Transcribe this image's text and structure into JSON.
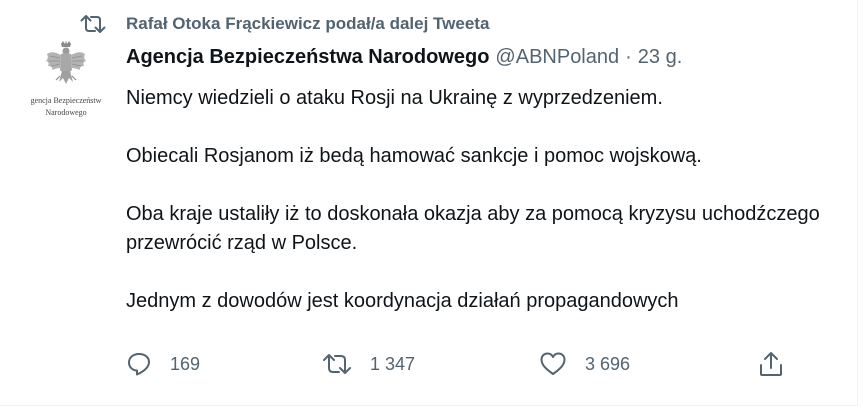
{
  "retweet_context": {
    "icon": "retweet-icon",
    "text": "Rafał Otoka Frąckiewicz podał/a dalej Tweeta"
  },
  "author": {
    "avatar_caption_line1": "gencja Bezpieczeństw",
    "avatar_caption_line2": "Narodowego",
    "name": "Agencja Bezpieczeństwa Narodowego",
    "handle": "@ABNPoland",
    "separator": "·",
    "time": "23 g."
  },
  "tweet": {
    "paragraph1": "Niemcy wiedzieli o ataku Rosji na Ukrainę z wyprzedzeniem.",
    "paragraph2": "Obiecali Rosjanom iż bedą hamować sankcje i pomoc wojskową.",
    "paragraph3": "Oba kraje ustaliły iż to doskonała okazja aby za pomocą kryzysu uchodźczego przewrócić rząd w Polsce.",
    "paragraph4": "Jednym z dowodów jest koordynacja działań propagandowych"
  },
  "actions": {
    "reply": {
      "icon": "reply-icon",
      "count": "169"
    },
    "retweet": {
      "icon": "retweet-icon",
      "count": "1 347"
    },
    "like": {
      "icon": "heart-icon",
      "count": "3 696"
    },
    "share": {
      "icon": "share-icon"
    }
  },
  "colors": {
    "text_primary": "#0f1419",
    "text_secondary": "#536471",
    "border": "#eff3f4"
  }
}
